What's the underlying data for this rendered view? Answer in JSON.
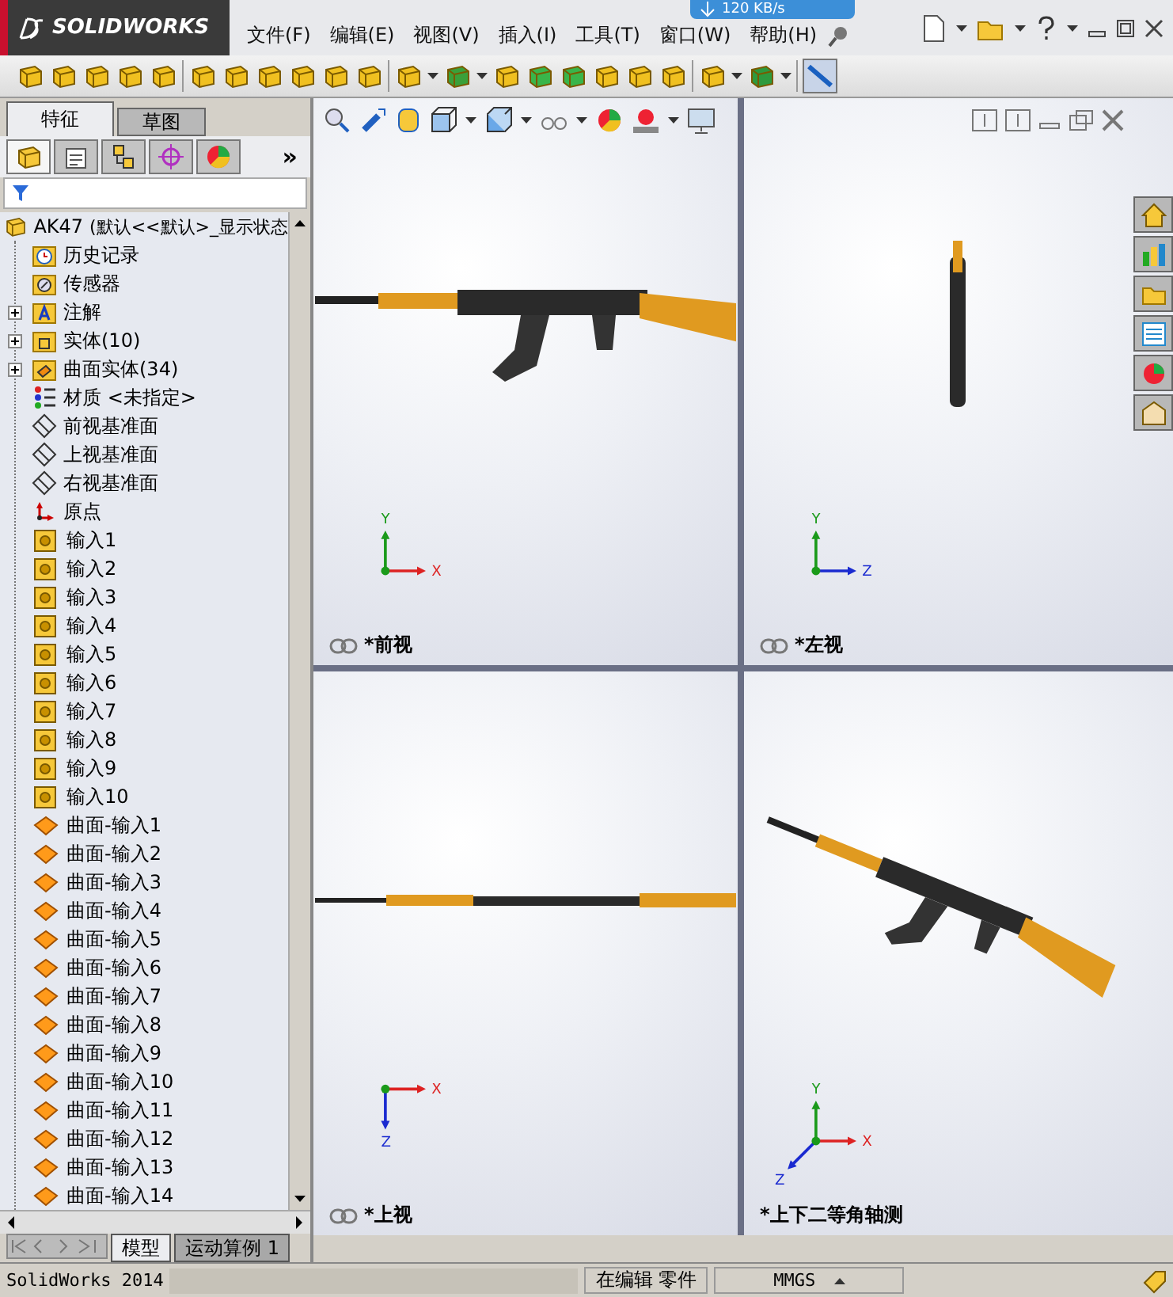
{
  "app": {
    "logo": "SOLIDWORKS",
    "menu": [
      "文件(F)",
      "编辑(E)",
      "视图(V)",
      "插入(I)",
      "工具(T)",
      "窗口(W)",
      "帮助(H)"
    ],
    "network_speed": "120 KB/s"
  },
  "feature_manager": {
    "tabs": [
      {
        "label": "特征",
        "selected": true
      },
      {
        "label": "草图",
        "selected": false
      }
    ],
    "panel_tabs": [
      {
        "kind": "feature",
        "selected": true
      },
      {
        "kind": "property",
        "selected": false
      },
      {
        "kind": "config",
        "selected": false
      },
      {
        "kind": "dimxpert",
        "selected": false
      },
      {
        "kind": "display",
        "selected": false
      }
    ],
    "more": "»",
    "tree": {
      "root": {
        "name": "AK47",
        "config": "(默认<<默认>_显示状态"
      },
      "items": [
        {
          "kind": "history",
          "label": "历史记录"
        },
        {
          "kind": "sensor",
          "label": "传感器"
        },
        {
          "kind": "annotation",
          "label": "注解",
          "collapsed": true
        },
        {
          "kind": "solid",
          "label": "实体(10)",
          "collapsed": true
        },
        {
          "kind": "surface-folder",
          "label": "曲面实体(34)",
          "collapsed": true
        },
        {
          "kind": "material",
          "label": "材质 <未指定>"
        },
        {
          "kind": "plane",
          "label": "前视基准面"
        },
        {
          "kind": "plane",
          "label": "上视基准面"
        },
        {
          "kind": "plane",
          "label": "右视基准面"
        },
        {
          "kind": "origin",
          "label": "原点"
        },
        {
          "kind": "import",
          "label": "输入1"
        },
        {
          "kind": "import",
          "label": "输入2"
        },
        {
          "kind": "import",
          "label": "输入3"
        },
        {
          "kind": "import",
          "label": "输入4"
        },
        {
          "kind": "import",
          "label": "输入5"
        },
        {
          "kind": "import",
          "label": "输入6"
        },
        {
          "kind": "import",
          "label": "输入7"
        },
        {
          "kind": "import",
          "label": "输入8"
        },
        {
          "kind": "import",
          "label": "输入9"
        },
        {
          "kind": "import",
          "label": "输入10"
        },
        {
          "kind": "surface",
          "label": "曲面-输入1"
        },
        {
          "kind": "surface",
          "label": "曲面-输入2"
        },
        {
          "kind": "surface",
          "label": "曲面-输入3"
        },
        {
          "kind": "surface",
          "label": "曲面-输入4"
        },
        {
          "kind": "surface",
          "label": "曲面-输入5"
        },
        {
          "kind": "surface",
          "label": "曲面-输入6"
        },
        {
          "kind": "surface",
          "label": "曲面-输入7"
        },
        {
          "kind": "surface",
          "label": "曲面-输入8"
        },
        {
          "kind": "surface",
          "label": "曲面-输入9"
        },
        {
          "kind": "surface",
          "label": "曲面-输入10"
        },
        {
          "kind": "surface",
          "label": "曲面-输入11"
        },
        {
          "kind": "surface",
          "label": "曲面-输入12"
        },
        {
          "kind": "surface",
          "label": "曲面-输入13"
        },
        {
          "kind": "surface",
          "label": "曲面-输入14"
        }
      ]
    },
    "bottom_tabs": [
      {
        "label": "模型",
        "selected": true
      },
      {
        "label": "运动算例 1",
        "selected": false
      }
    ]
  },
  "viewports": [
    {
      "kind": "front",
      "label": "*前视",
      "linked": true,
      "axes": [
        "Y",
        "X"
      ]
    },
    {
      "kind": "left",
      "label": "*左视",
      "linked": true,
      "axes": [
        "Y",
        "Z"
      ]
    },
    {
      "kind": "top",
      "label": "*上视",
      "linked": true,
      "axes": [
        "X",
        "Z"
      ]
    },
    {
      "kind": "iso",
      "label": "*上下二等角轴测",
      "linked": false,
      "axes": [
        "Y",
        "X",
        "Z"
      ]
    }
  ],
  "status_bar": {
    "app": "SolidWorks 2014",
    "mode": "在编辑 零件",
    "units": "MMGS"
  }
}
